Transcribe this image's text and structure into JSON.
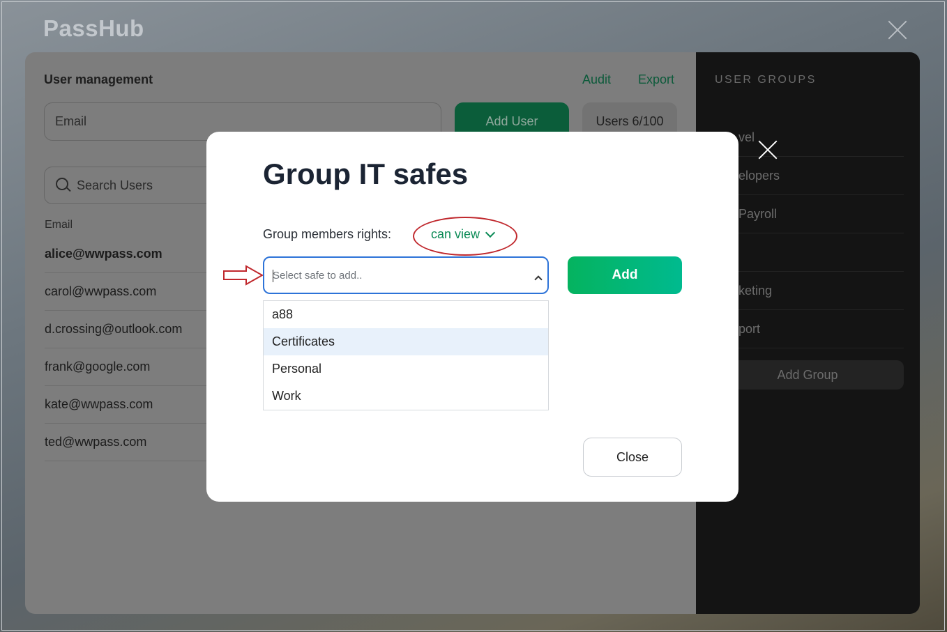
{
  "app": {
    "brand": "PassHub"
  },
  "user_management": {
    "title": "User management",
    "audit_label": "Audit",
    "export_label": "Export",
    "email_placeholder": "Email",
    "add_user_label": "Add User",
    "users_count": "Users 6/100",
    "search_placeholder": "Search Users",
    "column_email": "Email",
    "users": [
      "alice@wwpass.com",
      "carol@wwpass.com",
      "d.crossing@outlook.com",
      "frank@google.com",
      "kate@wwpass.com",
      "ted@wwpass.com"
    ]
  },
  "user_groups": {
    "title": "USER GROUPS",
    "items": [
      "vel",
      "elopers",
      "Payroll",
      "",
      "keting",
      "port"
    ],
    "add_group_label": "Add Group"
  },
  "modal": {
    "title": "Group IT safes",
    "rights_label": "Group members rights:",
    "rights_value": "can view",
    "select_placeholder": "Select safe to add..",
    "add_label": "Add",
    "options": [
      "a88",
      "Certificates",
      "Personal",
      "Work"
    ],
    "highlighted_option": "Certificates",
    "close_label": "Close"
  },
  "colors": {
    "accent": "#0a8a55",
    "annotation": "#c0282d",
    "focus": "#2d73d8"
  }
}
